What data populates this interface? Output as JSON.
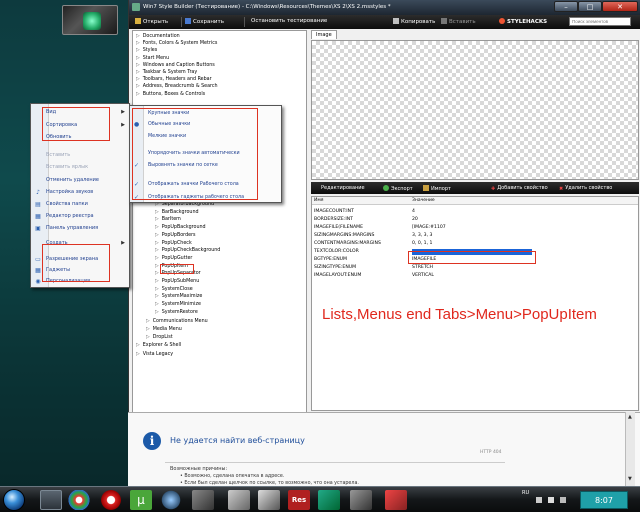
{
  "window": {
    "title": "Win7 Style Builder (Тестирование) - C:\\Windows\\Resources\\Themes\\XS 2\\XS 2.msstyles *"
  },
  "toolbar": {
    "open": "Открыть",
    "save": "Сохранить",
    "stop_test": "Остановить тестирование",
    "copy": "Копировать",
    "paste": "Вставить",
    "brand": "STYLEHACKS",
    "search_placeholder": "Поиск элементов"
  },
  "tree": {
    "top_items": [
      "Documentation",
      "Fonts, Colors & System Metrics",
      "Styles",
      "Start Menu",
      "Windows and Caption Buttons",
      "Taskbar & System Tray",
      "Toolbars, Headers and Rebar",
      "Address, Breadcrumb & Search",
      "Buttons, Boxes & Controls"
    ],
    "menu_items": [
      "SeparatorBackground",
      "BarBackground",
      "BarItem",
      "PopUpBackground",
      "PopUpBorders",
      "PopUpCheck",
      "PopUpCheckBackground",
      "PopUpGutter",
      "PopUpItem",
      "PopUpSeparator",
      "PopUpSubMenu",
      "SystemClose",
      "SystemMaximize",
      "SystemMinimize",
      "SystemRestore"
    ],
    "bottom_items": [
      "Communications Menu",
      "Media Menu",
      "DropList",
      "Explorer & Shell",
      "Vista Legacy"
    ]
  },
  "image_tab": "Image",
  "prop_toolbar": {
    "edit": "Редактирование",
    "export": "Экспорт",
    "import": "Импорт",
    "add": "Добавить свойство",
    "delete": "Удалить свойство"
  },
  "props": {
    "col_name": "Имя",
    "col_value": "Значение",
    "rows": [
      {
        "k": "IMAGECOUNT:INT",
        "v": "4"
      },
      {
        "k": "BORDERSIZE:INT",
        "v": "20"
      },
      {
        "k": "IMAGEFILE(FILENAME",
        "v": "[IMAGE:#1107"
      },
      {
        "k": "SIZINGMARGINS:MARGINS",
        "v": "3, 3, 3, 3"
      },
      {
        "k": "CONTENTMARGINS:MARGINS",
        "v": "0, 0, 1, 1"
      },
      {
        "k": "TEXTCOLOR:COLOR",
        "v": ""
      },
      {
        "k": "BGTYPE:ENUM",
        "v": "IMAGEFILE"
      },
      {
        "k": "SIZINGTYPE:ENUM",
        "v": "STRETCH"
      },
      {
        "k": "IMAGELAYOUT:ENUM",
        "v": "VERTICAL"
      }
    ],
    "textcolor": "#1a64d8"
  },
  "caption": "Lists,Menus end Tabs>Menu>PopUpItem",
  "browser": {
    "title": "Не удается найти веб-страницу",
    "code": "HTTP 404",
    "reasons_title": "Возможные причины:",
    "reason1": "Возможно, сделана опечатка в адресе.",
    "reason2": "Если был сделан щелчок по ссылке, то возможно, что она устарела."
  },
  "context_menu": {
    "items": [
      {
        "label": "Вид",
        "disabled": false
      },
      {
        "label": "Сортировка",
        "disabled": false
      },
      {
        "label": "Обновить",
        "disabled": false
      },
      {
        "label": "Вставить",
        "disabled": true
      },
      {
        "label": "Вставить ярлык",
        "disabled": true
      },
      {
        "label": "Отменить удаление",
        "disabled": false
      },
      {
        "label": "Настройка звуков",
        "disabled": false
      },
      {
        "label": "Свойства папки",
        "disabled": false
      },
      {
        "label": "Редактор реестра",
        "disabled": false
      },
      {
        "label": "Панель управления",
        "disabled": false
      },
      {
        "label": "Создать",
        "disabled": false
      },
      {
        "label": "Разрешение экрана",
        "disabled": false
      },
      {
        "label": "Гаджеты",
        "disabled": false
      },
      {
        "label": "Персонализация",
        "disabled": false
      }
    ]
  },
  "submenu": {
    "items": [
      "Крупные значки",
      "Обычные значки",
      "Мелкие значки",
      "Упорядочить значки автоматически",
      "Выровнять значки по сетке",
      "Отображать значки Рабочего стола",
      "Отображать гаджеты рабочего стола"
    ]
  },
  "taskbar": {
    "lang": "RU",
    "clock": "8:07"
  },
  "colors": {
    "highlight_red": "#d32",
    "caption_red": "#e0281d",
    "link_blue": "#1f3f8f"
  }
}
